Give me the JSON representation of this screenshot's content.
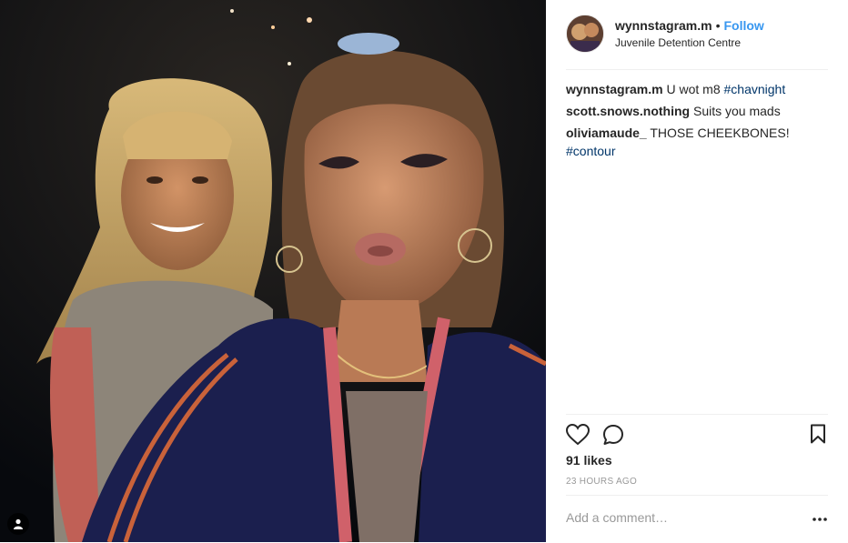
{
  "post": {
    "username": "wynnstagram.m",
    "separator": "•",
    "follow_label": "Follow",
    "location": "Juvenile Detention Centre"
  },
  "comments": [
    {
      "user": "wynnstagram.m",
      "text": "U wot m8 ",
      "hashtag": "#chavnight"
    },
    {
      "user": "scott.snows.nothing",
      "text": "Suits you mads",
      "hashtag": ""
    },
    {
      "user": "oliviamaude_",
      "text": "THOSE CHEEKBONES!",
      "hashtag": "#contour"
    }
  ],
  "likes_label": "91 likes",
  "timestamp": "23 HOURS AGO",
  "comment_placeholder": "Add a comment…",
  "icons": [
    "heart-icon",
    "comment-icon",
    "bookmark-icon",
    "more-options-icon",
    "tagged-user-icon"
  ],
  "colors": {
    "follow": "#3897f0",
    "hashtag": "#003569",
    "text": "#262626",
    "muted": "#999999"
  }
}
